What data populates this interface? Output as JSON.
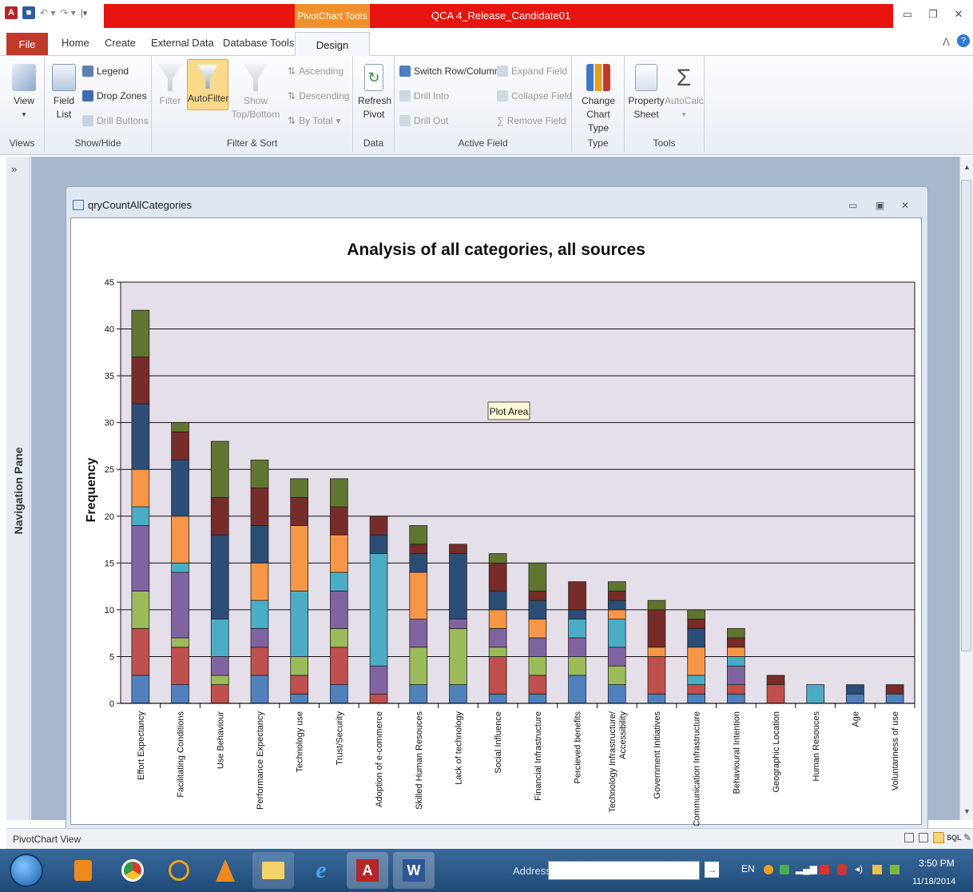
{
  "window": {
    "title": "QCA 4_Release_Candidate01",
    "context_tab": "PivotChart Tools"
  },
  "tabs": {
    "file": "File",
    "home": "Home",
    "create": "Create",
    "external_data": "External Data",
    "database_tools": "Database Tools",
    "design": "Design"
  },
  "ribbon": {
    "views": {
      "label": "Views",
      "view": "View"
    },
    "show_hide": {
      "label": "Show/Hide",
      "field_list_1": "Field",
      "field_list_2": "List",
      "legend": "Legend",
      "drop_zones": "Drop Zones",
      "drill_buttons": "Drill Buttons"
    },
    "filter_sort": {
      "label": "Filter & Sort",
      "filter": "Filter",
      "autofilter": "AutoFilter",
      "show_1": "Show",
      "show_2": "Top/Bottom",
      "ascending": "Ascending",
      "descending": "Descending",
      "by_total": "By Total"
    },
    "data": {
      "label": "Data",
      "refresh_1": "Refresh",
      "refresh_2": "Pivot"
    },
    "active_field": {
      "label": "Active Field",
      "switch": "Switch Row/Column",
      "drill_into": "Drill Into",
      "drill_out": "Drill Out",
      "expand": "Expand Field",
      "collapse": "Collapse Field",
      "remove": "Remove Field"
    },
    "type": {
      "label": "Type",
      "change_1": "Change",
      "change_2": "Chart Type"
    },
    "tools": {
      "label": "Tools",
      "property_1": "Property",
      "property_2": "Sheet",
      "autocalc": "AutoCalc"
    }
  },
  "nav_pane": {
    "label": "Navigation Pane",
    "toggle": "»"
  },
  "inner_window": {
    "title": "qryCountAllCategories"
  },
  "tooltip": "Plot Area",
  "status": {
    "text": "PivotChart View",
    "view_icons": "SQL"
  },
  "taskbar": {
    "address_label": "Address",
    "lang": "EN",
    "time": "3:50 PM",
    "date": "11/18/2014"
  },
  "colors": {
    "s1": "#4f81bd",
    "s2": "#c0504d",
    "s3": "#9bbb59",
    "s4": "#8064a2",
    "s5": "#4bacc6",
    "s6": "#f79646",
    "s7": "#2c4d75",
    "s8": "#772c2a",
    "s9": "#5f7530"
  },
  "chart_data": {
    "type": "bar",
    "stacked": true,
    "title": "Analysis of all categories, all sources",
    "xlabel": "",
    "ylabel": "Frequency",
    "ylim": [
      0,
      45
    ],
    "yticks": [
      0,
      5,
      10,
      15,
      20,
      25,
      30,
      35,
      40,
      45
    ],
    "grid": true,
    "categories": [
      "Effort Expectancy",
      "Facilitating Conditions",
      "Use Behaviour",
      "Performance Expectancy",
      "Technology use",
      "Trust/Security",
      "Adoption of e-commerce",
      "Skilled Human Resouces",
      "Lack of technology",
      "Social Influence",
      "Financial Infrastructure",
      "Percieved benefits",
      "Technology Infrastructure/ Accessibility",
      "Government Initiatives",
      "Communication Infrastructure",
      "Behavioural Intention",
      "Geographic Location",
      "Human Resouces",
      "Age",
      "Voluntariness of use"
    ],
    "series": [
      {
        "values": [
          3,
          2,
          0,
          3,
          1,
          2,
          0,
          2,
          2,
          1,
          1,
          3,
          2,
          1,
          1,
          1,
          0,
          0,
          1,
          1
        ]
      },
      {
        "values": [
          5,
          4,
          2,
          3,
          2,
          4,
          1,
          0,
          0,
          4,
          2,
          0,
          0,
          4,
          1,
          1,
          2,
          0,
          0,
          0
        ]
      },
      {
        "values": [
          4,
          1,
          1,
          0,
          2,
          2,
          0,
          4,
          6,
          1,
          2,
          2,
          2,
          0,
          0,
          0,
          0,
          0,
          0,
          0
        ]
      },
      {
        "values": [
          7,
          7,
          2,
          2,
          0,
          4,
          3,
          3,
          1,
          2,
          2,
          2,
          2,
          0,
          0,
          2,
          0,
          0,
          0,
          0
        ]
      },
      {
        "values": [
          2,
          1,
          4,
          3,
          7,
          2,
          12,
          0,
          0,
          0,
          0,
          2,
          3,
          0,
          1,
          1,
          0,
          2,
          0,
          0
        ]
      },
      {
        "values": [
          4,
          5,
          0,
          4,
          7,
          4,
          0,
          5,
          0,
          2,
          2,
          0,
          1,
          1,
          3,
          1,
          0,
          0,
          0,
          0
        ]
      },
      {
        "values": [
          7,
          6,
          9,
          4,
          0,
          0,
          2,
          2,
          7,
          2,
          2,
          1,
          1,
          0,
          2,
          0,
          0,
          0,
          1,
          0
        ]
      },
      {
        "values": [
          5,
          3,
          4,
          4,
          3,
          3,
          2,
          1,
          1,
          3,
          1,
          3,
          1,
          4,
          1,
          1,
          1,
          0,
          0,
          1
        ]
      },
      {
        "values": [
          5,
          1,
          6,
          3,
          2,
          3,
          0,
          2,
          0,
          1,
          3,
          0,
          1,
          1,
          1,
          1,
          0,
          0,
          0,
          0
        ]
      }
    ]
  }
}
